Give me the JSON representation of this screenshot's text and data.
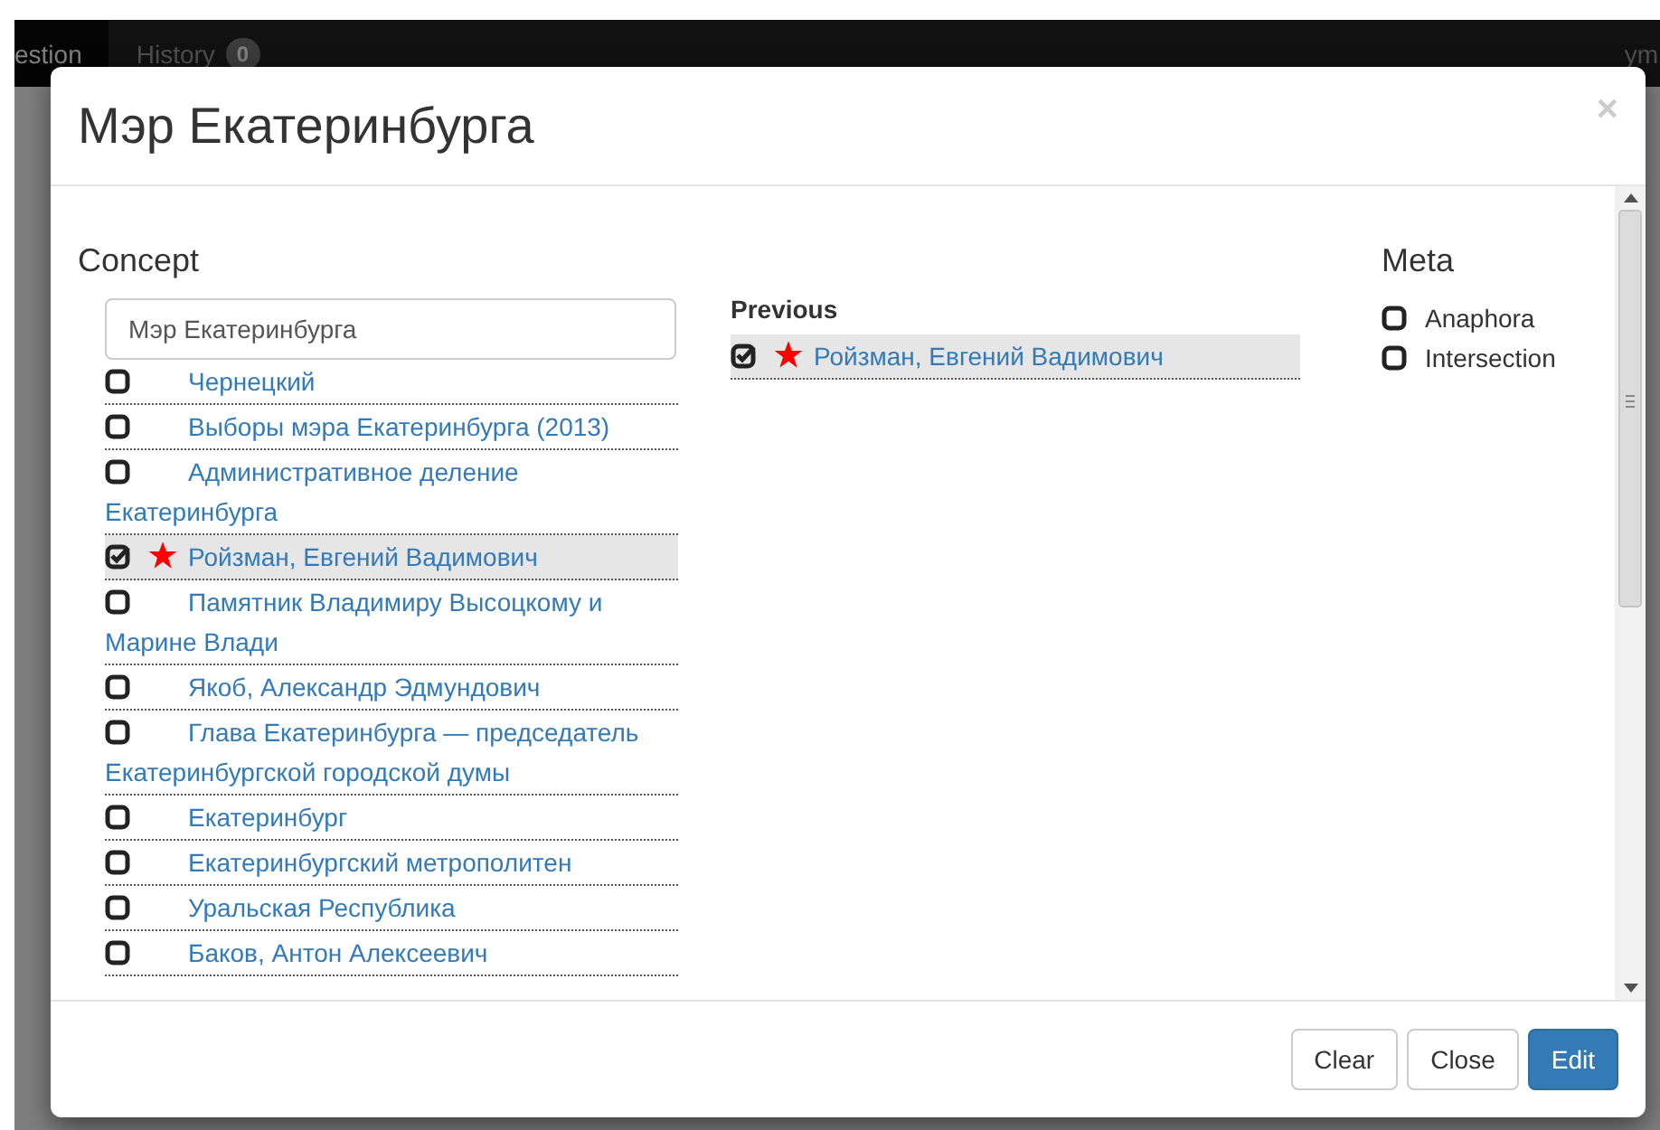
{
  "navbar": {
    "items": [
      {
        "label": "estion",
        "selected": true
      },
      {
        "label": "History",
        "badge": "0",
        "selected": false
      }
    ],
    "user": "ym"
  },
  "modal": {
    "title": "Мэр Екатеринбурга",
    "close": "×",
    "concept": {
      "heading": "Concept",
      "query": "Мэр Екатеринбурга",
      "items": [
        {
          "label": "Чернецкий",
          "checked": false,
          "starred": false
        },
        {
          "label": "Выборы мэра Екатеринбурга (2013)",
          "checked": false,
          "starred": false
        },
        {
          "label": "Административное деление Екатеринбурга",
          "checked": false,
          "starred": false
        },
        {
          "label": "Ройзман, Евгений Вадимович",
          "checked": true,
          "starred": true
        },
        {
          "label": "Памятник Владимиру Высоцкому и Марине Влади",
          "checked": false,
          "starred": false
        },
        {
          "label": "Якоб, Александр Эдмундович",
          "checked": false,
          "starred": false
        },
        {
          "label": "Глава Екатеринбурга — председатель Екатеринбургской городской думы",
          "checked": false,
          "starred": false
        },
        {
          "label": "Екатеринбург",
          "checked": false,
          "starred": false
        },
        {
          "label": "Екатеринбургский метрополитен",
          "checked": false,
          "starred": false
        },
        {
          "label": "Уральская Республика",
          "checked": false,
          "starred": false
        },
        {
          "label": "Баков, Антон Алексеевич",
          "checked": false,
          "starred": false
        }
      ]
    },
    "previous": {
      "heading": "Previous",
      "items": [
        {
          "label": "Ройзман, Евгений Вадимович",
          "checked": true,
          "starred": true
        }
      ]
    },
    "meta": {
      "heading": "Meta",
      "options": [
        {
          "label": "Anaphora",
          "checked": false
        },
        {
          "label": "Intersection",
          "checked": false
        }
      ]
    },
    "buttons": [
      {
        "label": "Clear",
        "kind": "default"
      },
      {
        "label": "Close",
        "kind": "default"
      },
      {
        "label": "Edit",
        "kind": "primary"
      }
    ]
  }
}
